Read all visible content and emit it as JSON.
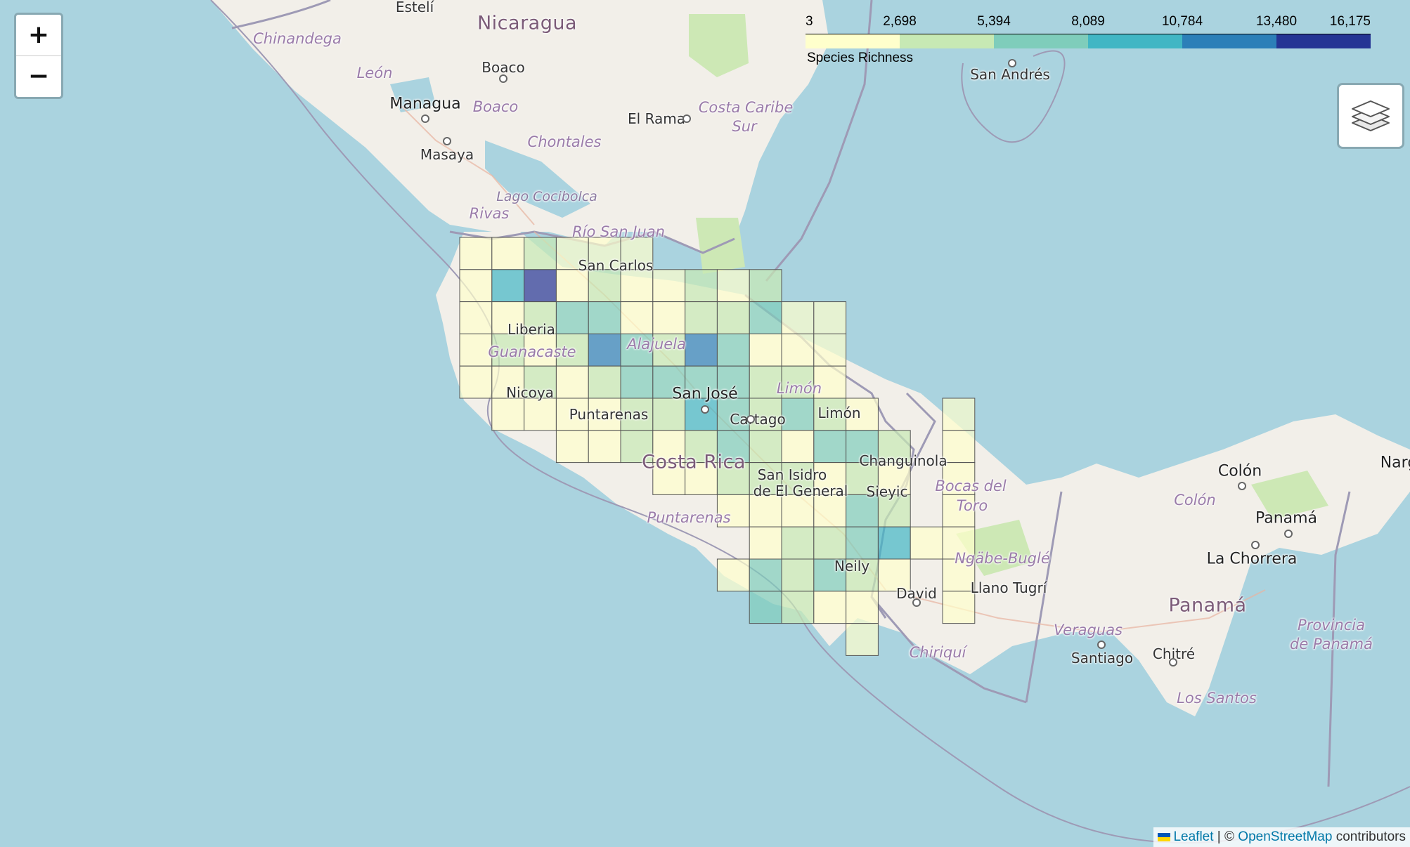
{
  "map": {
    "colors": {
      "sea": "#aad3df",
      "land": "#f2efe9",
      "forest": "#cde8b5",
      "border": "#9e9ab5",
      "grid_stroke": "#555555"
    },
    "labels": [
      {
        "text": "Nicaragua",
        "class": "country",
        "name": "country-label-nicaragua"
      },
      {
        "text": "Costa Rica",
        "class": "country",
        "name": "country-label-costa-rica"
      },
      {
        "text": "Panamá",
        "class": "country",
        "name": "country-label-panama"
      },
      {
        "text": "Estelí",
        "class": "city",
        "name": "city-label-esteli"
      },
      {
        "text": "Chinandega",
        "class": "region",
        "name": "region-label-chinandega"
      },
      {
        "text": "León",
        "class": "region",
        "name": "region-label-leon"
      },
      {
        "text": "Boaco",
        "class": "city",
        "name": "city-label-boaco"
      },
      {
        "text": "Boaco",
        "class": "region",
        "name": "region-label-boaco"
      },
      {
        "text": "Managua",
        "class": "capital",
        "name": "city-label-managua"
      },
      {
        "text": "Masaya",
        "class": "city",
        "name": "city-label-masaya"
      },
      {
        "text": "Chontales",
        "class": "region",
        "name": "region-label-chontales"
      },
      {
        "text": "El Rama",
        "class": "city",
        "name": "city-label-el-rama"
      },
      {
        "text": "Costa Caribe",
        "class": "region",
        "name": "region-label-costa-caribe"
      },
      {
        "text": "Sur",
        "class": "region",
        "name": "region-label-sur"
      },
      {
        "text": "San Andrés",
        "class": "city",
        "name": "city-label-san-andres"
      },
      {
        "text": "Lago Cocibolca",
        "class": "water",
        "name": "water-label-lago-cocibolca"
      },
      {
        "text": "Rivas",
        "class": "region",
        "name": "region-label-rivas"
      },
      {
        "text": "Río San Juan",
        "class": "region",
        "name": "region-label-rio-san-juan"
      },
      {
        "text": "San Carlos",
        "class": "city",
        "name": "city-label-san-carlos"
      },
      {
        "text": "Liberia",
        "class": "city",
        "name": "city-label-liberia"
      },
      {
        "text": "Guanacaste",
        "class": "region",
        "name": "region-label-guanacaste"
      },
      {
        "text": "Alajuela",
        "class": "region",
        "name": "region-label-alajuela"
      },
      {
        "text": "Nicoya",
        "class": "city",
        "name": "city-label-nicoya"
      },
      {
        "text": "San José",
        "class": "capital",
        "name": "city-label-san-jose"
      },
      {
        "text": "Limón",
        "class": "region",
        "name": "region-label-limon"
      },
      {
        "text": "Limón",
        "class": "city",
        "name": "city-label-limon"
      },
      {
        "text": "Puntarenas",
        "class": "city",
        "name": "city-label-puntarenas"
      },
      {
        "text": "Cartago",
        "class": "city",
        "name": "city-label-cartago"
      },
      {
        "text": "Changuinola",
        "class": "city",
        "name": "city-label-changuinola"
      },
      {
        "text": "San Isidro",
        "class": "city",
        "name": "city-label-san-isidro"
      },
      {
        "text": "de El General",
        "class": "city",
        "name": "city-label-de-el-general"
      },
      {
        "text": "Sieyic",
        "class": "city",
        "name": "city-label-sieyic"
      },
      {
        "text": "Bocas del",
        "class": "region",
        "name": "region-label-bocas-del"
      },
      {
        "text": "Toro",
        "class": "region",
        "name": "region-label-toro"
      },
      {
        "text": "Puntarenas",
        "class": "region",
        "name": "region-label-puntarenas"
      },
      {
        "text": "Ngäbe-Buglé",
        "class": "region",
        "name": "region-label-ngabe-bugle"
      },
      {
        "text": "Neily",
        "class": "city",
        "name": "city-label-neily"
      },
      {
        "text": "David",
        "class": "city",
        "name": "city-label-david"
      },
      {
        "text": "Llano Tugrí",
        "class": "city",
        "name": "city-label-llano-tugri"
      },
      {
        "text": "Chiriquí",
        "class": "region",
        "name": "region-label-chiriqui"
      },
      {
        "text": "Veraguas",
        "class": "region",
        "name": "region-label-veraguas"
      },
      {
        "text": "Santiago",
        "class": "city",
        "name": "city-label-santiago"
      },
      {
        "text": "Chitré",
        "class": "city",
        "name": "city-label-chitre"
      },
      {
        "text": "Los Santos",
        "class": "region",
        "name": "region-label-los-santos"
      },
      {
        "text": "Colón",
        "class": "capital",
        "name": "city-label-colon"
      },
      {
        "text": "Colón",
        "class": "region",
        "name": "region-label-colon"
      },
      {
        "text": "Panamá",
        "class": "capital",
        "name": "city-label-panama"
      },
      {
        "text": "La Chorrera",
        "class": "capital",
        "name": "city-label-la-chorrera"
      },
      {
        "text": "Provincia",
        "class": "region",
        "name": "region-label-provincia"
      },
      {
        "text": "de Panamá",
        "class": "region",
        "name": "region-label-de-panama"
      },
      {
        "text": "Narg",
        "class": "capital",
        "name": "city-label-narg"
      }
    ],
    "grid": {
      "scale_colors": [
        "#ffffcc",
        "#c7e9b4",
        "#7fcdbb",
        "#41b6c4",
        "#2c7fb8",
        "#253494"
      ],
      "cells": [
        [
          0,
          0,
          0
        ],
        [
          1,
          0,
          0
        ],
        [
          2,
          0,
          1
        ],
        [
          3,
          0,
          0
        ],
        [
          4,
          0,
          0
        ],
        [
          5,
          0,
          0
        ],
        [
          0,
          1,
          0
        ],
        [
          1,
          1,
          3
        ],
        [
          2,
          1,
          5
        ],
        [
          3,
          1,
          0
        ],
        [
          4,
          1,
          1
        ],
        [
          5,
          1,
          0
        ],
        [
          6,
          1,
          0
        ],
        [
          7,
          1,
          1
        ],
        [
          8,
          1,
          0
        ],
        [
          9,
          1,
          1
        ],
        [
          0,
          2,
          0
        ],
        [
          1,
          2,
          0
        ],
        [
          2,
          2,
          1
        ],
        [
          3,
          2,
          2
        ],
        [
          4,
          2,
          2
        ],
        [
          5,
          2,
          0
        ],
        [
          6,
          2,
          0
        ],
        [
          7,
          2,
          1
        ],
        [
          8,
          2,
          1
        ],
        [
          9,
          2,
          2
        ],
        [
          10,
          2,
          0
        ],
        [
          11,
          2,
          0
        ],
        [
          0,
          3,
          0
        ],
        [
          1,
          3,
          1
        ],
        [
          2,
          3,
          0
        ],
        [
          3,
          3,
          1
        ],
        [
          4,
          3,
          4
        ],
        [
          5,
          3,
          2
        ],
        [
          6,
          3,
          1
        ],
        [
          7,
          3,
          4
        ],
        [
          8,
          3,
          2
        ],
        [
          9,
          3,
          0
        ],
        [
          10,
          3,
          0
        ],
        [
          11,
          3,
          0
        ],
        [
          0,
          4,
          0
        ],
        [
          1,
          4,
          0
        ],
        [
          2,
          4,
          1
        ],
        [
          3,
          4,
          0
        ],
        [
          4,
          4,
          1
        ],
        [
          5,
          4,
          2
        ],
        [
          6,
          4,
          2
        ],
        [
          7,
          4,
          2
        ],
        [
          8,
          4,
          2
        ],
        [
          9,
          4,
          1
        ],
        [
          10,
          4,
          1
        ],
        [
          11,
          4,
          0
        ],
        [
          1,
          5,
          0
        ],
        [
          2,
          5,
          0
        ],
        [
          3,
          5,
          0
        ],
        [
          4,
          5,
          0
        ],
        [
          5,
          5,
          1
        ],
        [
          6,
          5,
          1
        ],
        [
          7,
          5,
          3
        ],
        [
          8,
          5,
          2
        ],
        [
          9,
          5,
          1
        ],
        [
          10,
          5,
          2
        ],
        [
          11,
          5,
          1
        ],
        [
          12,
          5,
          0
        ],
        [
          15,
          5,
          0
        ],
        [
          3,
          6,
          0
        ],
        [
          4,
          6,
          0
        ],
        [
          5,
          6,
          1
        ],
        [
          6,
          6,
          0
        ],
        [
          7,
          6,
          1
        ],
        [
          8,
          6,
          2
        ],
        [
          9,
          6,
          1
        ],
        [
          10,
          6,
          0
        ],
        [
          11,
          6,
          2
        ],
        [
          12,
          6,
          2
        ],
        [
          13,
          6,
          1
        ],
        [
          15,
          6,
          0
        ],
        [
          6,
          7,
          0
        ],
        [
          7,
          7,
          0
        ],
        [
          8,
          7,
          1
        ],
        [
          9,
          7,
          1
        ],
        [
          10,
          7,
          1
        ],
        [
          11,
          7,
          0
        ],
        [
          12,
          7,
          1
        ],
        [
          13,
          7,
          0
        ],
        [
          15,
          7,
          0
        ],
        [
          8,
          8,
          0
        ],
        [
          9,
          8,
          0
        ],
        [
          10,
          8,
          0
        ],
        [
          11,
          8,
          0
        ],
        [
          12,
          8,
          2
        ],
        [
          13,
          8,
          1
        ],
        [
          15,
          8,
          0
        ],
        [
          9,
          9,
          0
        ],
        [
          10,
          9,
          1
        ],
        [
          11,
          9,
          1
        ],
        [
          12,
          9,
          2
        ],
        [
          13,
          9,
          3
        ],
        [
          14,
          9,
          0
        ],
        [
          15,
          9,
          0
        ],
        [
          8,
          10,
          0
        ],
        [
          9,
          10,
          2
        ],
        [
          10,
          10,
          1
        ],
        [
          11,
          10,
          2
        ],
        [
          12,
          10,
          1
        ],
        [
          13,
          10,
          0
        ],
        [
          15,
          10,
          0
        ],
        [
          9,
          11,
          2
        ],
        [
          10,
          11,
          1
        ],
        [
          11,
          11,
          0
        ],
        [
          12,
          11,
          0
        ],
        [
          15,
          11,
          0
        ],
        [
          12,
          12,
          0
        ]
      ]
    }
  },
  "zoom": {
    "in_label": "+",
    "out_label": "−"
  },
  "legend": {
    "caption": "Species Richness",
    "ticks": [
      "3",
      "2,698",
      "5,394",
      "8,089",
      "10,784",
      "13,480",
      "16,175"
    ],
    "colors": [
      "#ffffcc",
      "#c7e9b4",
      "#7fcdbb",
      "#41b6c4",
      "#2c7fb8",
      "#253494"
    ]
  },
  "layers_control": {
    "icon": "layers-icon"
  },
  "attribution": {
    "leaflet": "Leaflet",
    "separator": "| ©",
    "osm": "OpenStreetMap",
    "suffix": "contributors"
  }
}
